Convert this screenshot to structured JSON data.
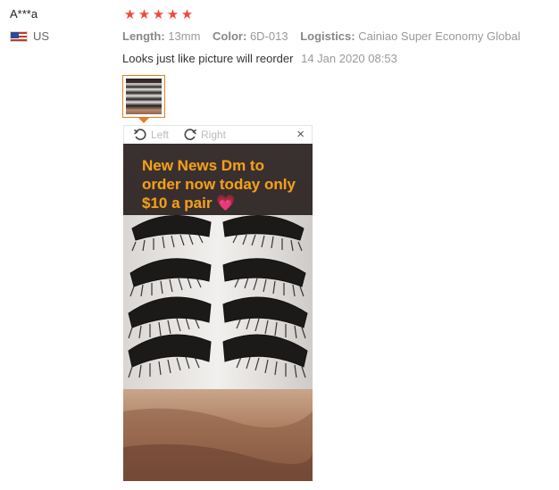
{
  "user": {
    "name": "A***a",
    "country": "US",
    "flag_icon": "us-flag-icon"
  },
  "review": {
    "rating": 5,
    "star_color": "#f04a3a",
    "attributes": [
      {
        "label": "Length:",
        "value": "13mm"
      },
      {
        "label": "Color:",
        "value": "6D-013"
      },
      {
        "label": "Logistics:",
        "value": "Cainiao Super Economy Global"
      }
    ],
    "text": "Looks just like picture will reorder",
    "date": "14 Jan 2020 08:53"
  },
  "viewer": {
    "rotate_left_label": "Left",
    "rotate_right_label": "Right",
    "close_icon": "×",
    "accent_color": "#e67e22",
    "photo_caption": "New News Dm to order now today only $10 a pair 💗"
  }
}
